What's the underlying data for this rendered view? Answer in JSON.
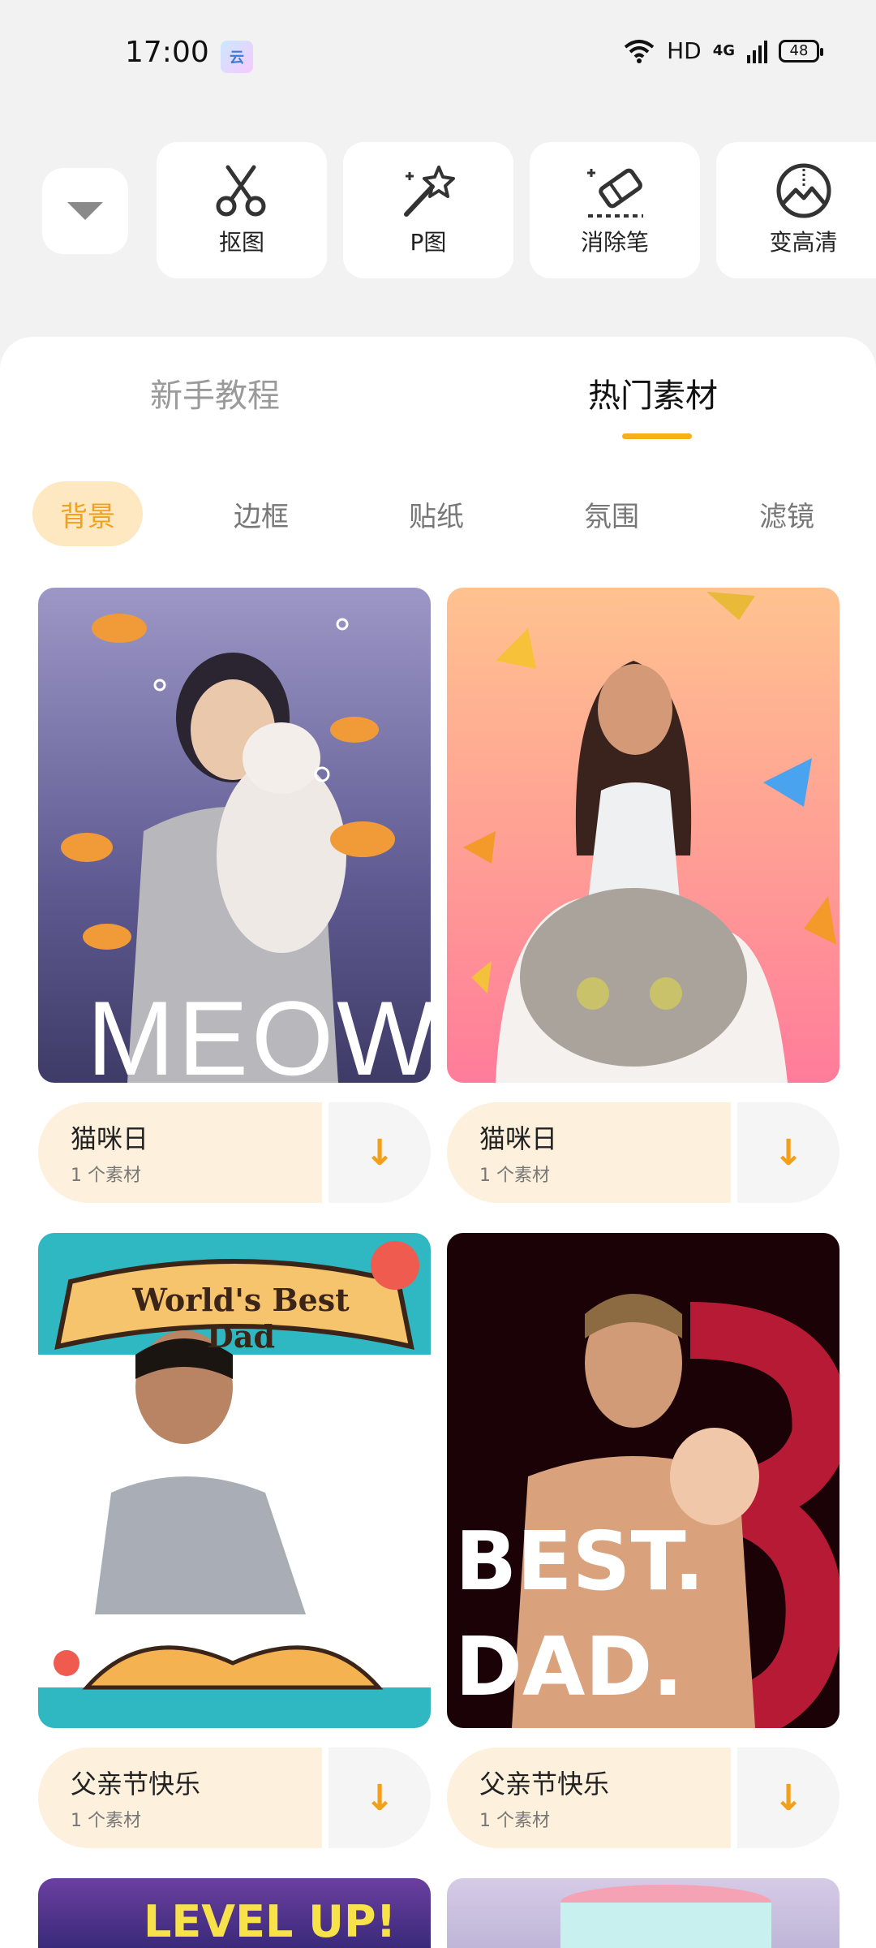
{
  "status": {
    "time": "17:00",
    "app_badge": "云",
    "hd": "HD",
    "network": "4G",
    "battery": "48"
  },
  "tools": [
    {
      "label": "抠图",
      "icon": "scissors-icon"
    },
    {
      "label": "P图",
      "icon": "magic-wand-icon"
    },
    {
      "label": "消除笔",
      "icon": "eraser-icon"
    },
    {
      "label": "变高清",
      "icon": "enhance-icon"
    }
  ],
  "tabs": [
    "新手教程",
    "热门素材"
  ],
  "chips": [
    "背景",
    "边框",
    "贴纸",
    "氛围",
    "滤镜"
  ],
  "cards": [
    {
      "name": "猫咪日",
      "count": "1 个素材",
      "art_text": "MEOW"
    },
    {
      "name": "猫咪日",
      "count": "1 个素材"
    },
    {
      "name": "父亲节快乐",
      "count": "1 个素材",
      "art_text": "World's Best Dad"
    },
    {
      "name": "父亲节快乐",
      "count": "1 个素材",
      "art_text": "BEST. DAD."
    }
  ],
  "bottom_art": {
    "left": "LEVEL UP!"
  },
  "colors": {
    "accent": "#f6b11a",
    "chip_bg": "#fde8c2",
    "card_bar": "#fdf0dc"
  }
}
